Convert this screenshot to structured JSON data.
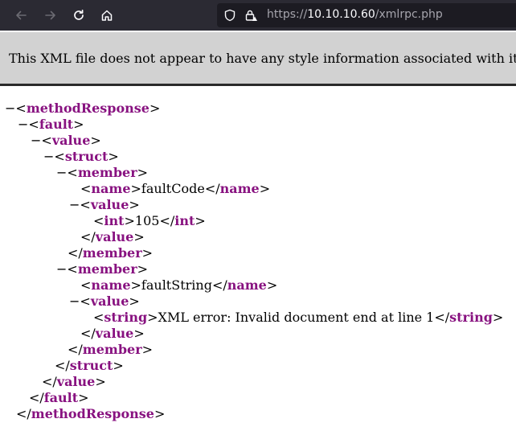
{
  "browser": {
    "url_scheme": "https://",
    "url_host": "10.10.10.60",
    "url_path": "/xmlrpc.php"
  },
  "banner": {
    "message": "This XML file does not appear to have any style information associated with it"
  },
  "xml": {
    "toggle": "−",
    "lt": "<",
    "lt_close": "</",
    "gt": ">",
    "tags": {
      "methodResponse": "methodResponse",
      "fault": "fault",
      "value": "value",
      "struct": "struct",
      "member": "member",
      "name": "name",
      "int": "int",
      "string": "string"
    },
    "values": {
      "fault_code_name": "faultCode",
      "fault_code_value": "105",
      "fault_string_name": "faultString",
      "fault_string_value": "XML error: Invalid document end at line 1"
    }
  }
}
